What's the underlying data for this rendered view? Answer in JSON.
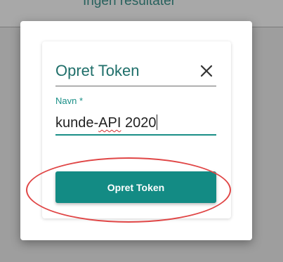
{
  "background": {
    "title": "Ingen resultater"
  },
  "dialog": {
    "title": "Opret Token",
    "close_icon": "close-icon",
    "field": {
      "label": "Navn *",
      "value_prefix": "kunde-",
      "value_misspelled": "API",
      "value_suffix": " 2020"
    },
    "submit_label": "Opret Token"
  },
  "colors": {
    "accent": "#138b84",
    "title": "#1f6f6a",
    "annotation": "#e04646"
  }
}
